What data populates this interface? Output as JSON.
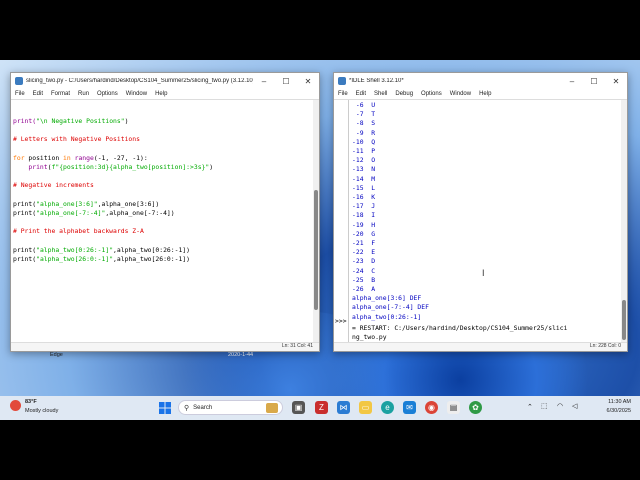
{
  "editor": {
    "title": "slicing_two.py - C:/Users/hardind/Desktop/CS104_Summer25/slicing_two.py (3.12.10)",
    "menu": [
      "File",
      "Edit",
      "Format",
      "Run",
      "Options",
      "Window",
      "Help"
    ],
    "status": "Ln: 31  Col: 41",
    "lines": [
      [
        [
          "print(",
          "bi"
        ],
        [
          "\"\\n Negative Positions\"",
          "str"
        ],
        [
          ")",
          "pl"
        ]
      ],
      [
        [
          "",
          "pl"
        ]
      ],
      [
        [
          "# Letters with Negative Positions",
          "cm"
        ]
      ],
      [
        [
          "",
          "pl"
        ]
      ],
      [
        [
          "for",
          "kw"
        ],
        [
          " position ",
          "pl"
        ],
        [
          "in",
          "kw"
        ],
        [
          " ",
          "pl"
        ],
        [
          "range",
          "bi"
        ],
        [
          "(-1, -27, -1):",
          "pl"
        ]
      ],
      [
        [
          "    ",
          "pl"
        ],
        [
          "print",
          "bi"
        ],
        [
          "(",
          "pl"
        ],
        [
          "f\"{position:3d}{alpha_two[position]:>3s}\"",
          "str"
        ],
        [
          ")",
          "pl"
        ]
      ],
      [
        [
          "",
          "pl"
        ]
      ],
      [
        [
          "# Negative increments",
          "cm"
        ]
      ],
      [
        [
          "",
          "pl"
        ]
      ],
      [
        [
          "print(",
          "pl"
        ],
        [
          "\"alpha_one[3:6]\"",
          "str"
        ],
        [
          ",alpha_one[3:6])",
          "pl"
        ]
      ],
      [
        [
          "print(",
          "pl"
        ],
        [
          "\"alpha_one[-7:-4]\"",
          "str"
        ],
        [
          ",alpha_one[-7:-4])",
          "pl"
        ]
      ],
      [
        [
          "",
          "pl"
        ]
      ],
      [
        [
          "# Print the alphabet backwards Z-A",
          "cm"
        ]
      ],
      [
        [
          "",
          "pl"
        ]
      ],
      [
        [
          "print(",
          "pl"
        ],
        [
          "\"alpha_two[0:26:-1]\"",
          "str"
        ],
        [
          ",alpha_two[0:26:-1])",
          "pl"
        ]
      ],
      [
        [
          "print(",
          "pl"
        ],
        [
          "\"alpha_two[26:0:-1]\"",
          "str"
        ],
        [
          ",alpha_two[26:0:-1])",
          "pl"
        ]
      ]
    ]
  },
  "shell": {
    "title": "*IDLE Shell 3.12.10*",
    "menu": [
      "File",
      "Edit",
      "Shell",
      "Debug",
      "Options",
      "Window",
      "Help"
    ],
    "status": "Ln: 228  Col: 0",
    "rows": [
      [
        "-6",
        "U"
      ],
      [
        "-7",
        "T"
      ],
      [
        "-8",
        "S"
      ],
      [
        "-9",
        "R"
      ],
      [
        "-10",
        "Q"
      ],
      [
        "-11",
        "P"
      ],
      [
        "-12",
        "O"
      ],
      [
        "-13",
        "N"
      ],
      [
        "-14",
        "M"
      ],
      [
        "-15",
        "L"
      ],
      [
        "-16",
        "K"
      ],
      [
        "-17",
        "J"
      ],
      [
        "-18",
        "I"
      ],
      [
        "-19",
        "H"
      ],
      [
        "-20",
        "G"
      ],
      [
        "-21",
        "F"
      ],
      [
        "-22",
        "E"
      ],
      [
        "-23",
        "D"
      ],
      [
        "-24",
        "C"
      ],
      [
        "-25",
        "B"
      ],
      [
        "-26",
        "A"
      ]
    ],
    "results": [
      "alpha_one[3:6] DEF",
      "alpha_one[-7:-4] DEF",
      "alpha_two[0:26:-1]"
    ],
    "prompt": ">>>",
    "restart_1": "= RESTART: C:/Users/hardind/Desktop/CS104_Summer25/slici",
    "restart_2": "ng_two.py"
  },
  "desktop": {
    "edge_label": "Edge",
    "date_stamp": "2020-1-44"
  },
  "taskbar": {
    "weather_temp": "83°F",
    "weather_desc": "Mostly cloudy",
    "search_placeholder": "Search",
    "time": "11:30 AM",
    "date": "6/30/2025"
  }
}
